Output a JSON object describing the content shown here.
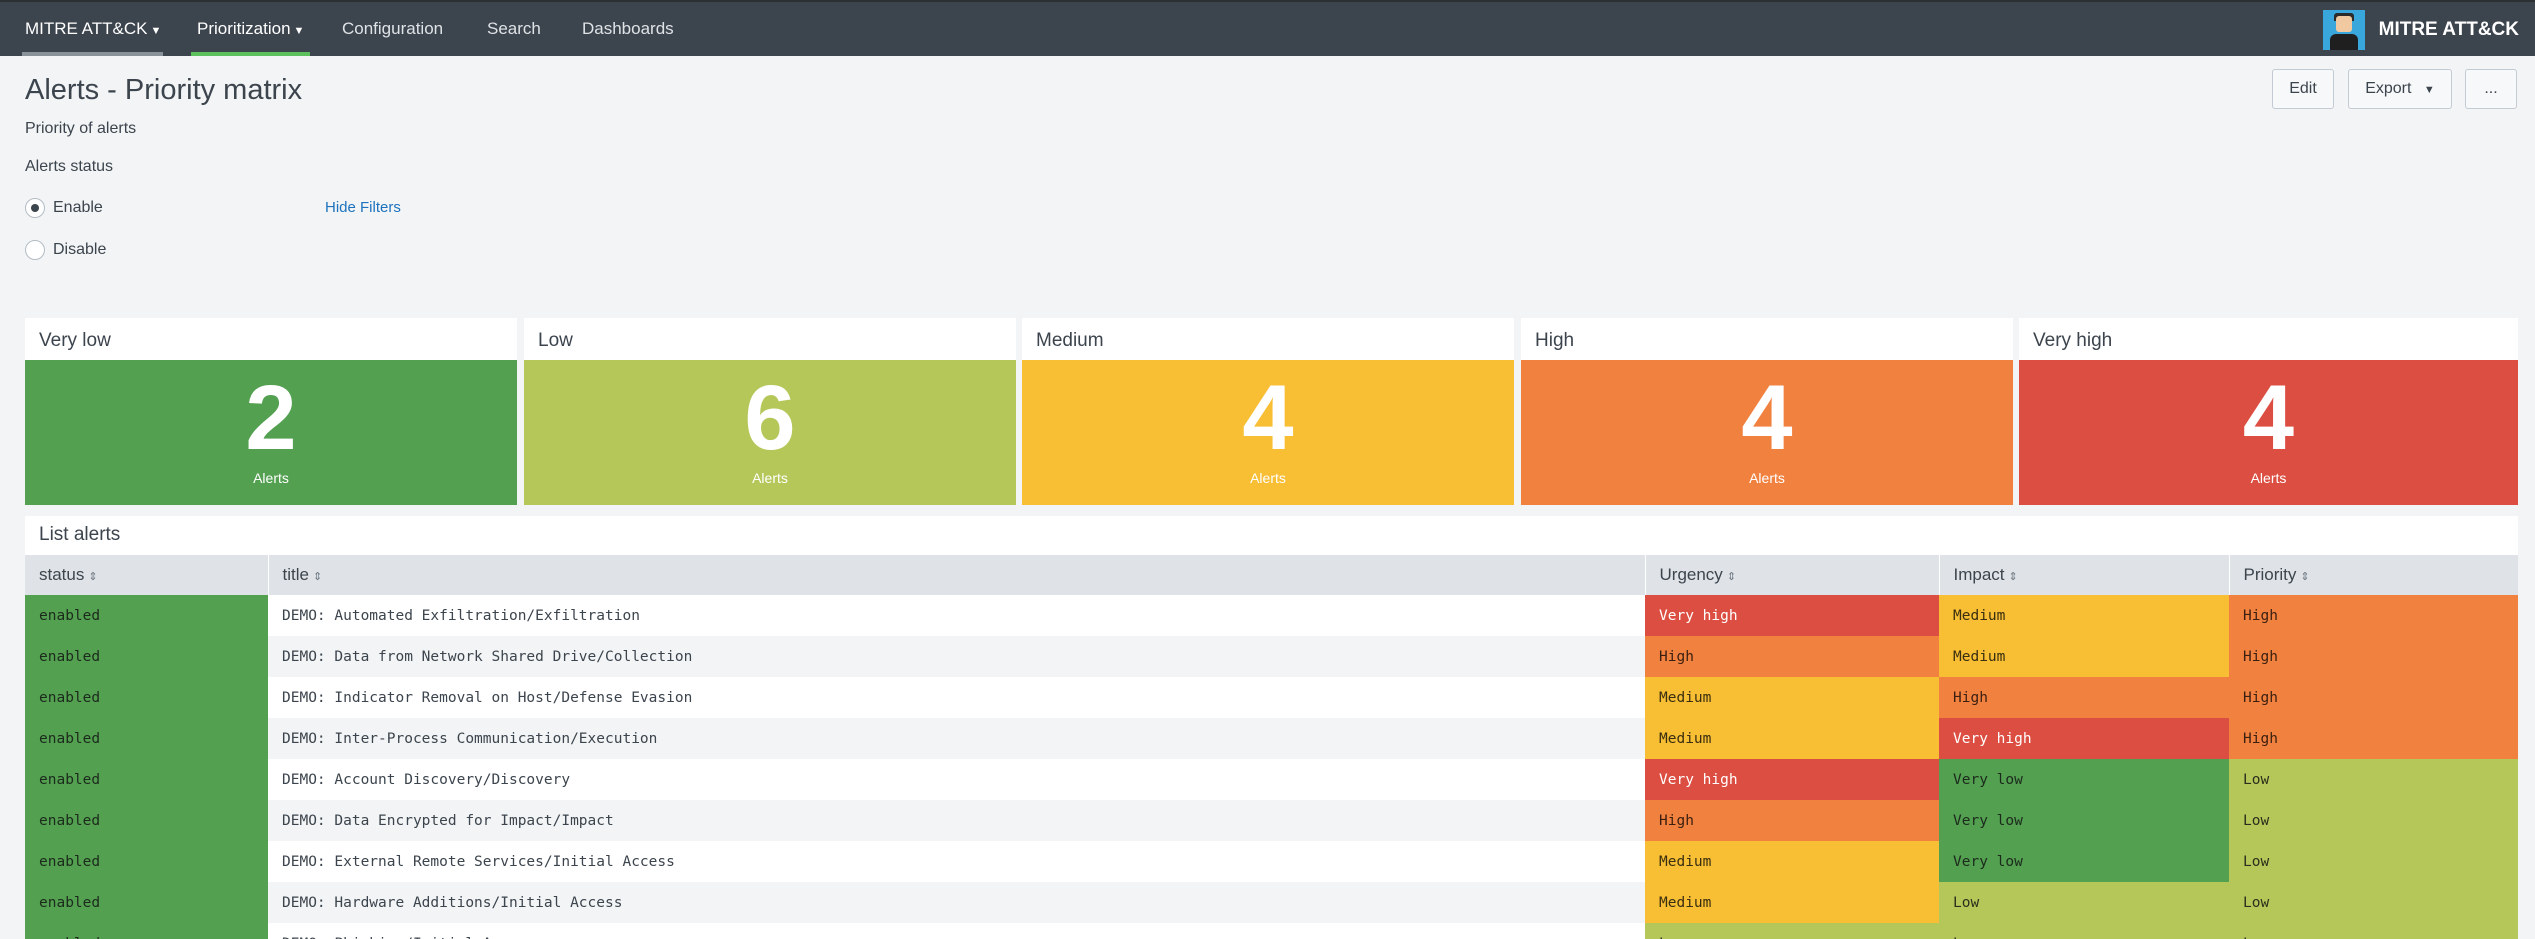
{
  "nav": {
    "app_label": "MITRE ATT&CK",
    "items": [
      {
        "label": "Prioritization",
        "active": true,
        "dropdown": true
      },
      {
        "label": "Configuration"
      },
      {
        "label": "Search"
      },
      {
        "label": "Dashboards"
      }
    ],
    "brand_text": "MITRE ATT&CK"
  },
  "header": {
    "title": "Alerts - Priority matrix",
    "description": "Priority of alerts",
    "edit_label": "Edit",
    "export_label": "Export",
    "more_label": "..."
  },
  "filters": {
    "label": "Alerts status",
    "options": [
      {
        "label": "Enable",
        "selected": true
      },
      {
        "label": "Disable",
        "selected": false
      }
    ],
    "hide_label": "Hide Filters"
  },
  "panels": [
    {
      "title": "Very low",
      "value": "2",
      "unit": "Alerts",
      "color": "#53a051"
    },
    {
      "title": "Low",
      "value": "6",
      "unit": "Alerts",
      "color": "#b6c75a"
    },
    {
      "title": "Medium",
      "value": "4",
      "unit": "Alerts",
      "color": "#f8be34"
    },
    {
      "title": "High",
      "value": "4",
      "unit": "Alerts",
      "color": "#f1813f"
    },
    {
      "title": "Very high",
      "value": "4",
      "unit": "Alerts",
      "color": "#dc4e41"
    }
  ],
  "table": {
    "title": "List alerts",
    "columns": [
      "status",
      "title",
      "Urgency",
      "Impact",
      "Priority"
    ],
    "rows": [
      {
        "status": "enabled",
        "title": "DEMO: Automated Exfiltration/Exfiltration",
        "urgency": "Very high",
        "impact": "Medium",
        "priority": "High"
      },
      {
        "status": "enabled",
        "title": "DEMO: Data from Network Shared Drive/Collection",
        "urgency": "High",
        "impact": "Medium",
        "priority": "High"
      },
      {
        "status": "enabled",
        "title": "DEMO: Indicator Removal on Host/Defense Evasion",
        "urgency": "Medium",
        "impact": "High",
        "priority": "High"
      },
      {
        "status": "enabled",
        "title": "DEMO: Inter-Process Communication/Execution",
        "urgency": "Medium",
        "impact": "Very high",
        "priority": "High"
      },
      {
        "status": "enabled",
        "title": "DEMO: Account Discovery/Discovery",
        "urgency": "Very high",
        "impact": "Very low",
        "priority": "Low"
      },
      {
        "status": "enabled",
        "title": "DEMO: Data Encrypted for Impact/Impact",
        "urgency": "High",
        "impact": "Very low",
        "priority": "Low"
      },
      {
        "status": "enabled",
        "title": "DEMO: External Remote Services/Initial Access",
        "urgency": "Medium",
        "impact": "Very low",
        "priority": "Low"
      },
      {
        "status": "enabled",
        "title": "DEMO: Hardware Additions/Initial Access",
        "urgency": "Medium",
        "impact": "Low",
        "priority": "Low"
      },
      {
        "status": "enabled",
        "title": "DEMO: Phishing/Initial Access",
        "urgency": "Low",
        "impact": "Low",
        "priority": "Low"
      }
    ]
  }
}
